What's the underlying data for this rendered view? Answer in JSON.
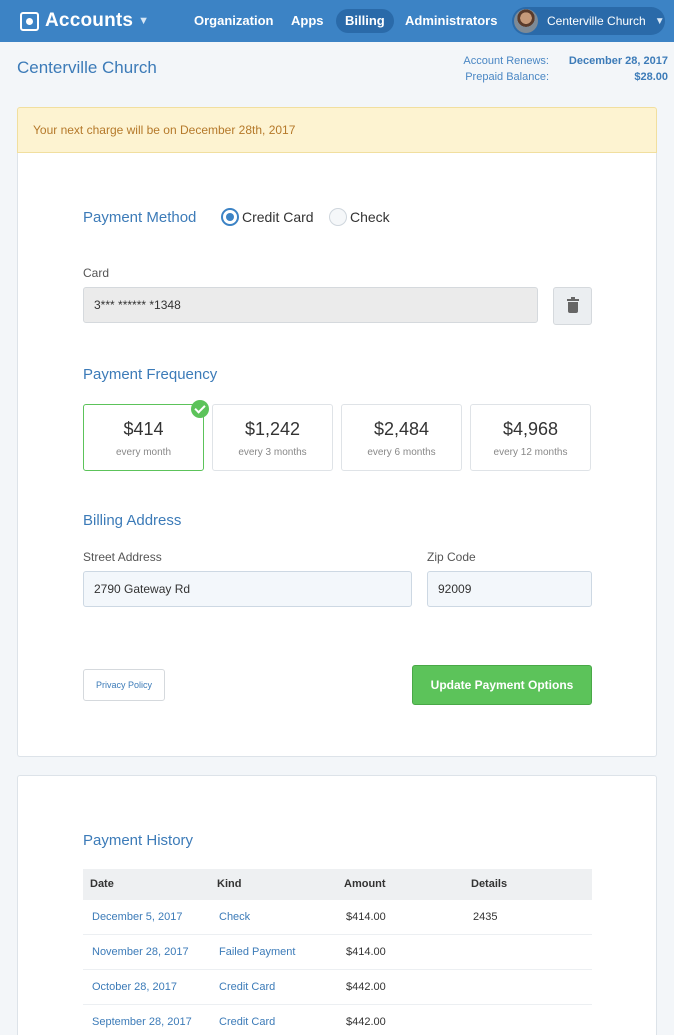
{
  "nav": {
    "brand": "Accounts",
    "items": [
      {
        "label": "Organization",
        "active": false
      },
      {
        "label": "Apps",
        "active": false
      },
      {
        "label": "Billing",
        "active": true
      },
      {
        "label": "Administrators",
        "active": false
      }
    ],
    "account": "Centerville Church"
  },
  "header": {
    "title": "Centerville Church",
    "renews_label": "Account Renews:",
    "renews_value": "December 28, 2017",
    "balance_label": "Prepaid Balance:",
    "balance_value": "$28.00"
  },
  "alert": {
    "text": "Your next charge will be on December 28th, 2017"
  },
  "payment": {
    "method_title": "Payment Method",
    "options": [
      "Credit Card",
      "Check"
    ],
    "selected": "Credit Card",
    "card_label": "Card",
    "card_value": "3*** ****** *1348",
    "frequency_title": "Payment Frequency",
    "frequencies": [
      {
        "price": "$414",
        "period": "every month",
        "selected": true
      },
      {
        "price": "$1,242",
        "period": "every 3 months",
        "selected": false
      },
      {
        "price": "$2,484",
        "period": "every 6 months",
        "selected": false
      },
      {
        "price": "$4,968",
        "period": "every 12 months",
        "selected": false
      }
    ],
    "address_title": "Billing Address",
    "street_label": "Street Address",
    "street_value": "2790 Gateway Rd",
    "zip_label": "Zip Code",
    "zip_value": "92009",
    "privacy_label": "Privacy Policy",
    "update_label": "Update Payment Options"
  },
  "history": {
    "title": "Payment History",
    "columns": [
      "Date",
      "Kind",
      "Amount",
      "Details"
    ],
    "rows": [
      {
        "date": "December 5, 2017",
        "kind": "Check",
        "amount": "$414.00",
        "details": "2435"
      },
      {
        "date": "November 28, 2017",
        "kind": "Failed Payment",
        "amount": "$414.00",
        "details": ""
      },
      {
        "date": "October 28, 2017",
        "kind": "Credit Card",
        "amount": "$442.00",
        "details": ""
      },
      {
        "date": "September 28, 2017",
        "kind": "Credit Card",
        "amount": "$442.00",
        "details": ""
      }
    ]
  },
  "colors": {
    "primary": "#3c83c5",
    "success": "#5cc35a",
    "alert_bg": "#fdf3d1"
  }
}
